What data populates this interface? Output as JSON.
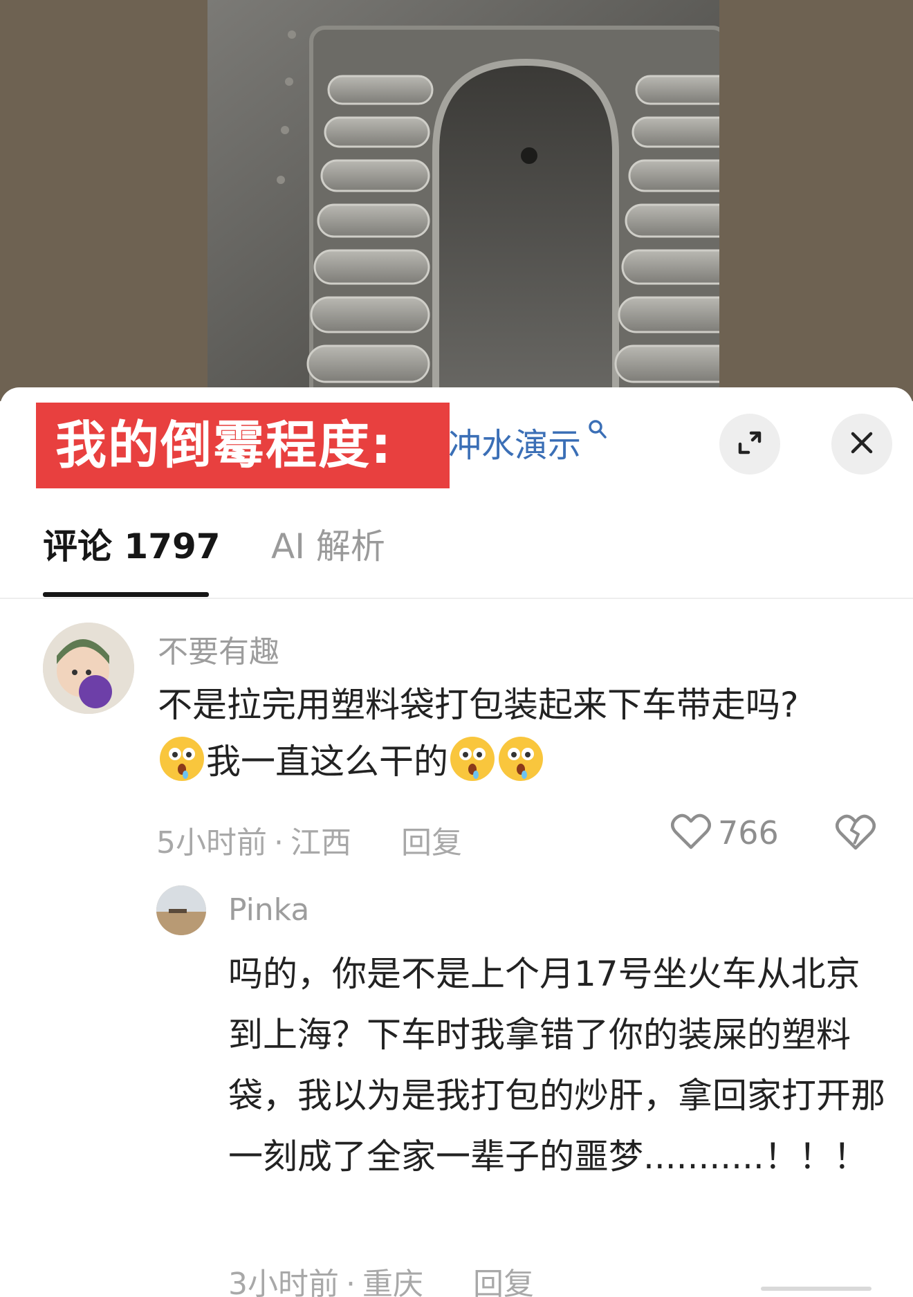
{
  "header": {
    "overlay_banner": "我的倒霉程度:",
    "search_suggestion": "冲水演示"
  },
  "tabs": [
    {
      "label": "评论 1797",
      "active": true
    },
    {
      "label": "AI 解析",
      "active": false
    }
  ],
  "comments": [
    {
      "username": "不要有趣",
      "text_line1": "不是拉完用塑料袋打包装起来下车带走吗?",
      "text_line2": "我一直这么干的",
      "emoji": "drooling-surprised-face",
      "time": "5小时前",
      "location": "江西",
      "reply_label": "回复",
      "likes": "766"
    },
    {
      "username": "Pinka",
      "text": "吗的，你是不是上个月17号坐火车从北京到上海？下车时我拿错了你的装屎的塑料袋，我以为是我打包的炒肝，拿回家打开那一刻成了全家一辈子的噩梦...........！！！",
      "time": "3小时前",
      "location": "重庆",
      "reply_label": "回复"
    }
  ],
  "colors": {
    "banner_red": "#e8403f",
    "link_blue": "#3b6fb6"
  }
}
